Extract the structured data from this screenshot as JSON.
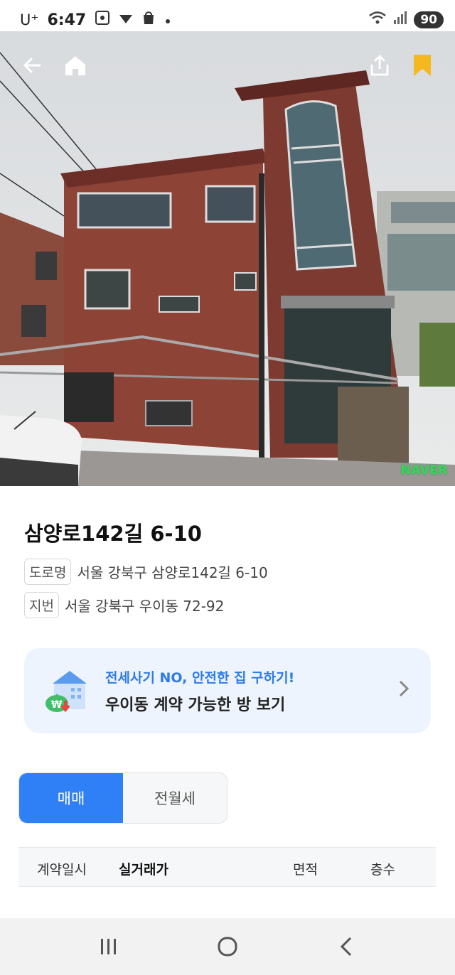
{
  "status_bar": {
    "carrier": "U⁺",
    "time": "6:47",
    "battery": "90"
  },
  "hero": {
    "back_icon": "arrow-left-icon",
    "home_icon": "home-icon",
    "share_icon": "share-icon",
    "bookmark_icon": "bookmark-icon",
    "watermark": "NAVER",
    "bookmark_color": "#f5b81f"
  },
  "address": {
    "title": "삼양로142길 6-10",
    "road_tag": "도로명",
    "road_value": "서울 강북구 삼양로142길 6-10",
    "lot_tag": "지번",
    "lot_value": "서울 강북구 우이동 72-92"
  },
  "banner": {
    "line1": "전세사기 NO, 안전한 집 구하기!",
    "line2": "우이동 계약 가능한 방 보기",
    "accent_color": "#2e7be6"
  },
  "tabs": [
    {
      "label": "매매",
      "active": true
    },
    {
      "label": "전월세",
      "active": false
    }
  ],
  "table": {
    "columns": [
      "계약일시",
      "실거래가",
      "면적",
      "층수"
    ]
  },
  "nav": {
    "recent_icon": "recent-apps-icon",
    "home_icon": "home-circle-icon",
    "back_icon": "back-chevron-icon"
  }
}
